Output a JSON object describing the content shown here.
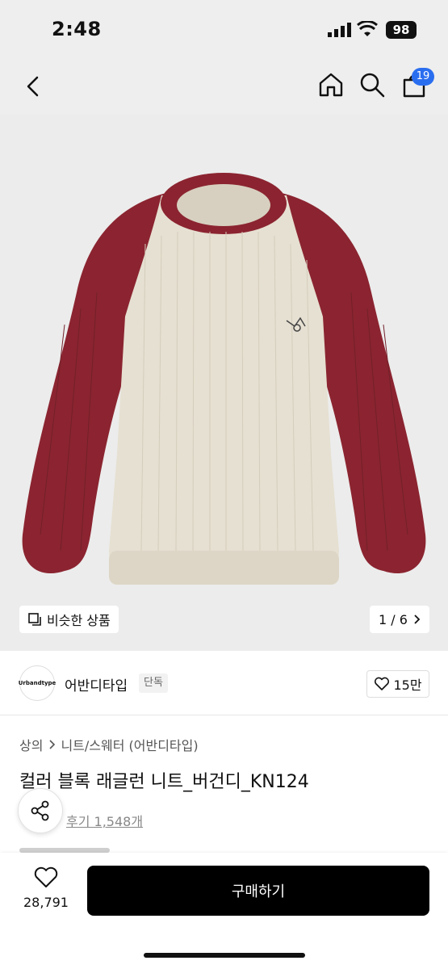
{
  "status": {
    "time": "2:48",
    "battery": "98"
  },
  "nav": {
    "bag_count": "19"
  },
  "hero": {
    "similar_label": "비슷한 상품",
    "pager": "1 / 6"
  },
  "brand": {
    "logo_text": "Urbandtype",
    "name": "어반디타입",
    "tag": "단독",
    "likes": "15만"
  },
  "product": {
    "breadcrumb": [
      "상의",
      "니트/스웨터 (어반디타입)"
    ],
    "title": "컬러 블록 래글런 니트_버건디_KN124",
    "review": "후기 1,548개"
  },
  "bottom": {
    "wish_count": "28,791",
    "buy_label": "구매하기"
  },
  "colors": {
    "accent": "#2a6ef0",
    "burgundy": "#8b2430",
    "cream": "#e6e0d2"
  }
}
